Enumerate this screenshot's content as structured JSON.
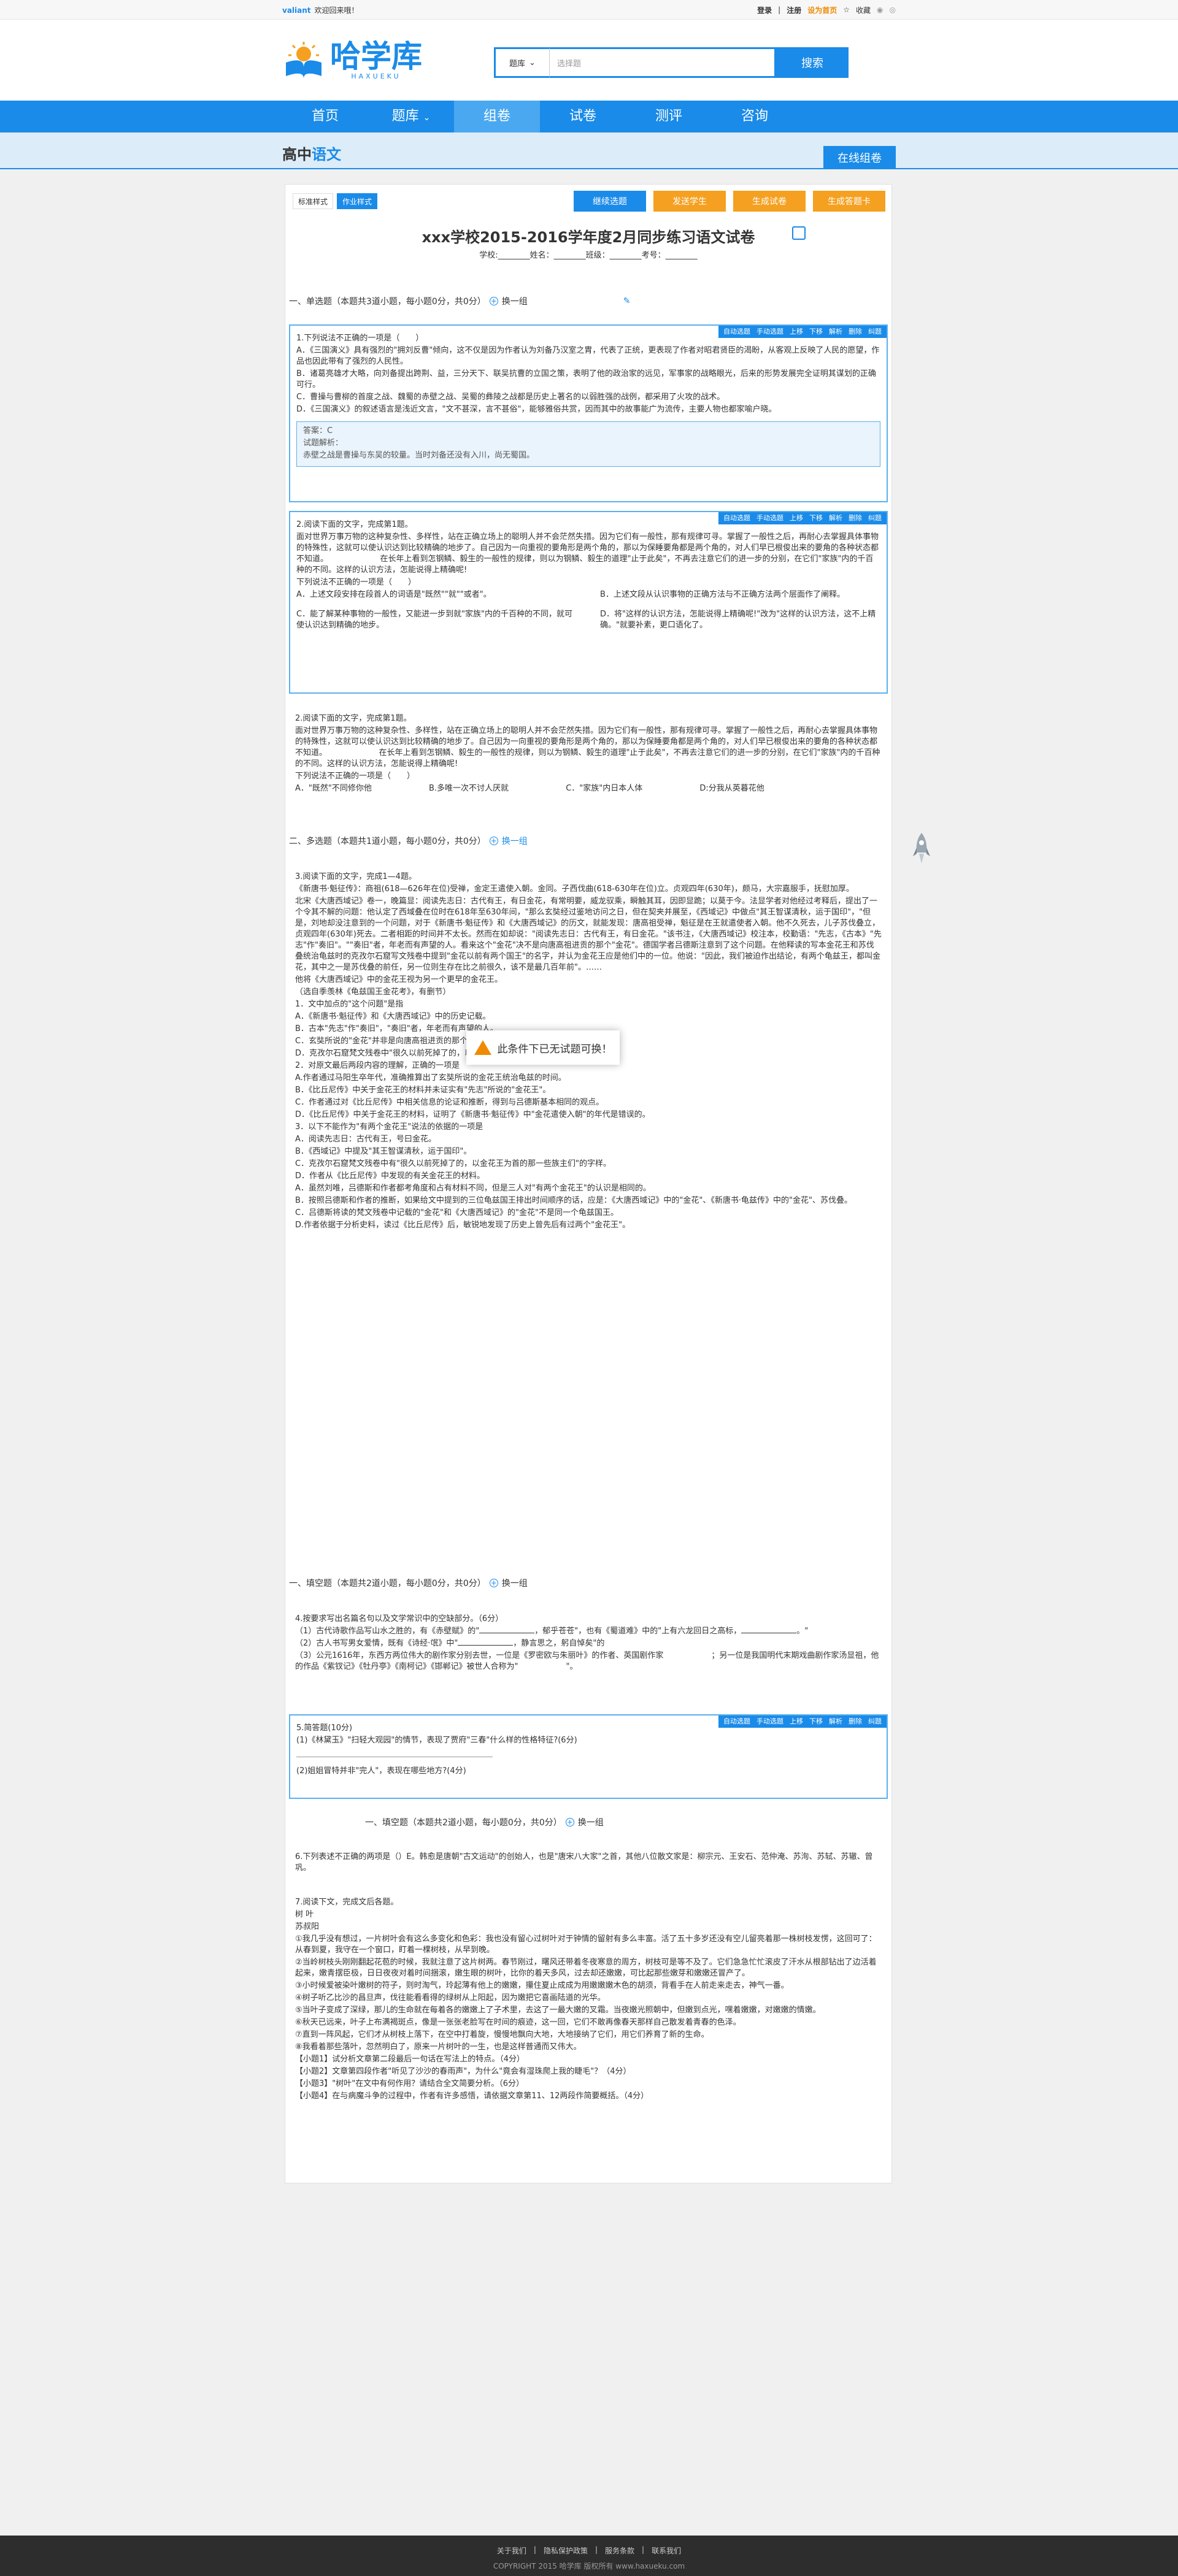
{
  "topbar": {
    "brand": "valiant",
    "welcome": "欢迎回来哦！",
    "login": "登录",
    "sep": "|",
    "register": "注册",
    "vip": "设为首页",
    "collect": "收藏"
  },
  "header": {
    "logo_text": "哈学库",
    "logo_sub": "HAXUEKU",
    "search_scope": "题库",
    "search_placeholder": "选择题",
    "search_button": "搜索"
  },
  "nav": [
    "首页",
    "题库",
    "组卷",
    "试卷",
    "测评",
    "咨询"
  ],
  "band": {
    "title_a": "高中",
    "title_b": "语文",
    "button": "在线组卷"
  },
  "paper": {
    "tabs": [
      "标准样式",
      "作业样式"
    ],
    "actions": [
      "继续选题",
      "发送学生",
      "生成试卷",
      "生成答题卡"
    ],
    "title": "xxx学校2015-2016学年度2月同步练习语文试卷",
    "info": "学校:________姓名：________班级：________考号：________",
    "sec1": "一、单选题（本题共3道小题，每小题0分，共0分）",
    "swap": "换一组",
    "qbar": [
      "自动选题",
      "手动选题",
      "上移",
      "下移",
      "解析",
      "删除",
      "纠题"
    ],
    "q1": {
      "stem": "1.下列说法不正确的一项是（　　）",
      "A": "A．《三国演义》具有强烈的\"拥刘反曹\"倾向，这不仅是因为作者认为刘备乃汉室之胄，代表了正统，更表现了作者对昭君贤臣的渴盼，从客观上反映了人民的愿望，作品也因此带有了强烈的人民性。",
      "B": "B．诸葛亮雄才大略，向刘备提出跨荆、益，三分天下、联吴抗曹的立国之策，表明了他的政治家的远见，军事家的战略眼光，后来的形势发展完全证明其谋划的正确可行。",
      "C": "C．曹操与曹柳的首度之战、魏蜀的赤壁之战、吴蜀的彝陵之战都是历史上著名的以弱胜强的战例，都采用了火攻的战术。",
      "D": "D．《三国演义》的叙述语言是浅近文言，\"文不甚深，言不甚俗\"，能够雅俗共赏，因而其中的故事能广为流传，主要人物也都家喻户晓。",
      "answer": "答案：C",
      "analysis": "试题解析：",
      "note": "赤壁之战是曹操与东吴的较量。当时刘备还没有入川，尚无蜀国。"
    },
    "q2": {
      "stem": "2.阅读下面的文字，完成第1题。",
      "p1": "面对世界万事万物的这种复杂性、多样性，站在正确立场上的聪明人并不会茫然失措。因为它们有一般性，那有规律可寻。掌握了一般性之后，再耐心去掌握具体事物的特殊性，这就可以使认识达到比较精确的地步了。自己因为一向重视的要角形是两个角的，那以为保睡要角都是两个角的，对人们早已根俊出来的要角的各种状态都不知道。　　　　　　　在长年上看到怎钢鳞、毅生的一般性的规律，则以为钢鳞、毅生的道理\"止于此矣\"，不再去注意它们的进一步的分别，在它们\"家族\"内的千百种的不同。这样的认识方法，怎能说得上精确呢!",
      "p2": "下列说法不正确的一项是（　　）",
      "A": "A．上述文段安排在段首人的词语是\"既然\"\"就\"\"或者\"。",
      "B": "B．上述文段从认识事物的正确方法与不正确方法两个层面作了阐释。",
      "C": "C．能了解某种事物的一般性，又能进一步到就\"家族\"内的千百种的不同，就可使认识达到精确的地步。",
      "D": "D．将\"这样的认识方法，怎能说得上精确呢!\"改为\"这样的认识方法，这不上精确。\"就要补素，更口语化了。"
    },
    "q2b": {
      "stem": "2.阅读下面的文字，完成第1题。",
      "p2": "下列说法不正确的一项是（　　）",
      "A": "A．\"既然\"不同修你他",
      "B": "B.多唯一次不讨人厌就",
      "C": "C．\"家族\"内日本人体",
      "D": "D:分我从英暮花他"
    },
    "sec2": "二、多选题（本题共1道小题，每小题0分，共0分）",
    "q3": {
      "stem": "3.阅读下面的文字，完成1—4题。",
      "lines": [
        "《新唐书·魁征传》：商祖(618—626年在位)受禅，金定王遣使入朝。金同。子西伐曲(618-630年在位)立。贞观四年(630年)，颇马，大宗嘉服手，抚慰加厚。",
        "北宋《大唐西域记》卷一，晚篇显：阅读先志日：古代有王，有日金花，有常明要，威龙驭乘，瞬触其耳，因即显跪；以莫于今。法显学者对他经过考释后，提出了一个令其不解的问题：他认定了西域叠在位时在618年至630年间，\"那么玄奘经过鉴地访问之日，但在契夹并展至，《西域记》中做点\"其王智谋清秋，运于国印\"，\"但是，刘地却没注意到的一个问题，对于《新唐书·魁征传》和《大唐西域记》的历文，就能发现：唐高祖受禅，魁征是在王就遣使者入朝。他不久死去，儿子苏伐叠立，贞观四年(630年)死去。二者相距的时间并不太长。然而在如却说：\"阅读先志日：古代有王，有日金花。\"该书注，《大唐西域记》校注本，校勤语：\"先志，《古本》\"先志\"作\"奏旧\"。\"\"奏旧\"者，年老而有声望的人。看来这个\"金花\"决不是向唐高祖进贡的那个\"金花\"。德国学者吕德斯注意到了这个问题。在他释读的写本金花王和苏伐叠统治龟兹时的克孜尔石窟写文残卷中提到\"金花以前有两个国王\"的名字，并认为金花王应是他们中的一位。他说：\"因此，我们被迫作出结论，有两个龟兹王，都叫金花，其中之一是苏伐叠的前任，另一位则生存在比之前很久，该不是最几百年前\"。……",
        "他将《大唐西域记》中的金花王视为另一个更早的金花王。",
        "（选自季羡林《龟兹国王金花考》，有删节）",
        "1．文中加点的\"这个问题\"是指",
        "A．《新唐书·魁征传》和《大唐西域记》中的历史记载。",
        "B．古本\"先志\"作\"奏旧\"，\"奏旧\"者，年老而有声望的人。",
        "C．玄奘所说的\"金花\"并非是向唐高祖进贡的那个\"金花\"。",
        "D．克孜尔石窟梵文残卷中\"很久以前死掉了的，以金花王为首的那一些族主们\"的记载。",
        "2．对原文最后两段内容的理解，正确的一项是",
        "A.作者通过马阳生卒年代，准确推算出了玄奘所说的金花王统治龟兹的时间。",
        "B．《比丘尼传》中关于金花王的材料并未证实有\"先志\"所说的\"金花王\"。",
        "C．作者通过对《比丘尼传》中相关信息的论证和推断，得到与吕德斯基本相同的观点。",
        "D．《比丘尼传》中关于金花王的材料，证明了《新唐书·魁征传》中\"金花遣使入朝\"的年代是错误的。",
        "3．以下不能作为\"有两个金花王\"说法的依据的一项是",
        "A．阅读先志日：古代有王，号曰金花。",
        "B．《西域记》中提及\"其王智谋清秋，运于国印\"。",
        "C．克孜尔石窟梵文残卷中有\"很久以前死掉了的，以金花王为首的那一些族主们\"的字样。",
        "D．作者从《比丘尼传》中发现的有关金花王的材料。",
        "A．虽然刘唯，吕德斯和作者都考角度和占有材料不同，但是三人对\"有两个金花王\"的认识是相同的。",
        "B．按照吕德斯和作者的推断，如果给文中提到的三位龟兹国王排出时间顺序的话，应是：《大唐西域记》中的\"金花\"、《新唐书·龟兹传》中的\"金花\"、苏伐叠。",
        "C．吕德斯将读的梵文残卷中记载的\"金花\"和《大唐西域记》的\"金花\"不是同一个龟兹国王。",
        "D.作者依据于分析史料，读过《比丘尼传》后，敏锐地发现了历史上曾先后有过两个\"金花王\"。"
      ]
    },
    "toast": "此条件下已无试题可换！",
    "sec3": "一、填空题（本题共2道小题，每小题0分，共0分）",
    "q4": {
      "stem": "4.按要求写出名篇名句以及文学常识中的空缺部分。（6分）",
      "l1a": "（1）古代诗歌作品写山水之胜的，有《赤壁赋》的\"",
      "l1b": "，郁乎苍苍\"，也有《蜀道难》中的\"上有六龙回日之高标，",
      "l1c": "。\"",
      "l2a": "（2）古人书写男女爱情，既有《诗经·氓》中\"",
      "l2b": "，静言思之，躬自悼矣\"的",
      "l3": "（3）公元1616年，东西方两位伟大的剧作家分别去世，一位是《罗密欧与朱丽叶》的作者、英国剧作家　　　　　　；另一位是我国明代末期戏曲剧作家汤显祖，他的作品《紫钗记》《牡丹亭》《南柯记》《邯郸记》被世人合称为\"　　　　　　\"。"
    },
    "q5": {
      "stem": "5.简答题(10分)",
      "a": "(1)《林黛玉》\"扫轻大观园\"的情节，表现了贾府\"三春\"什么样的性格特征?(6分)",
      "b": "(2)姐姐冒特并非\"完人\"，表现在哪些地方?(4分)"
    },
    "sec4": "一、填空题（本题共2道小题，每小题0分，共0分）",
    "q6": "6.下列表述不正确的两项是（）E。韩愈是唐朝\"古文运动\"的创始人，也是\"唐宋八大家\"之首，其他八位散文家是：柳宗元、王安石、范仲淹、苏洵、苏轼、苏辙、曾巩。",
    "q7": {
      "stem": "7.阅读下文，完成文后各题。",
      "title": "树 叶",
      "author": "苏叔阳",
      "paras": [
        "①我几乎没有想过，一片树叶会有这么多变化和色彩：我也没有留心过树叶对于钟情的留射有多么丰富。活了五十多岁还没有空儿留亮着那一株树枝发愣，这回可了：从春到夏，我守在一个窗口，盯着一棵树枝，从早到晚。",
        "②当岭树枝头刚刚翻起花苞的时候，我就注意了这片树两。春节刚过，曙风还带着冬夜寒意的周方，树枝可是等不及了。它们急急忙忙滚皮了汗水从根部钻出了边活着起来，嫩青摆臣极，日日夜夜对着时间捆滚，嫩生眼的树叶，比你的着天多风，过去却还嫩嫩，可比起那些嫩芽和嫩嫩还冒产了。",
        "③小时候爱被染叶嫩树的符子，则时淘气，玲起薄有他上的嫩嫩，攥住夏止成成为用嫩嫩嫩木色的胡须，背看手在人前走来走去，神气一番。",
        "④树子听乙比沙的昌旦声，伐往能看看得的绿树从上阳起，因为嫩把它喜画陆道的光华。",
        "⑤当叶子变成了深绿，那儿的生命就在每着各的嫩嫩上了子术里，去这了一最大嫩的叉霜。当夜嫩光照朝中，但嫩到点光，嘿着嫩嫩，对嫩嫩的情嫩。",
        "⑥秋天已远来，叶子上布满褐斑点，像是一张张老脸写在时间的痕迹，这一回，它们不敢再像春天那样自己散发着青春的色泽。",
        "⑦直到一阵风起，它们才从树枝上落下，在空中打着旋，慢慢地飘向大地，大地接纳了它们，用它们养育了新的生命。",
        "⑧我看着那些落叶，忽然明白了，原来一片树叶的一生，也是这样普通而又伟大。"
      ],
      "qs": [
        "【小题1】试分析文章第二段最后一句话在写法上的特点。（4分）",
        "【小题2】文章第四段作者\"听见了沙沙的春雨声\"，为什么\"竟会有湿珠爬上我的睫毛\"？（4分）",
        "【小题3】\"树叶\"在文中有何作用？请结合全文简要分析。（6分）",
        "【小题4】在与病魔斗争的过程中，作者有许多感悟，请依据文章第11、12两段作简要概括。（4分）"
      ]
    }
  },
  "footer": {
    "links": [
      "关于我们",
      "|",
      "隐私保护政策",
      "|",
      "服务条款",
      "|",
      "联系我们"
    ],
    "copy": "COPYRIGHT 2015  哈学库  版权所有  www.haxueku.com"
  }
}
